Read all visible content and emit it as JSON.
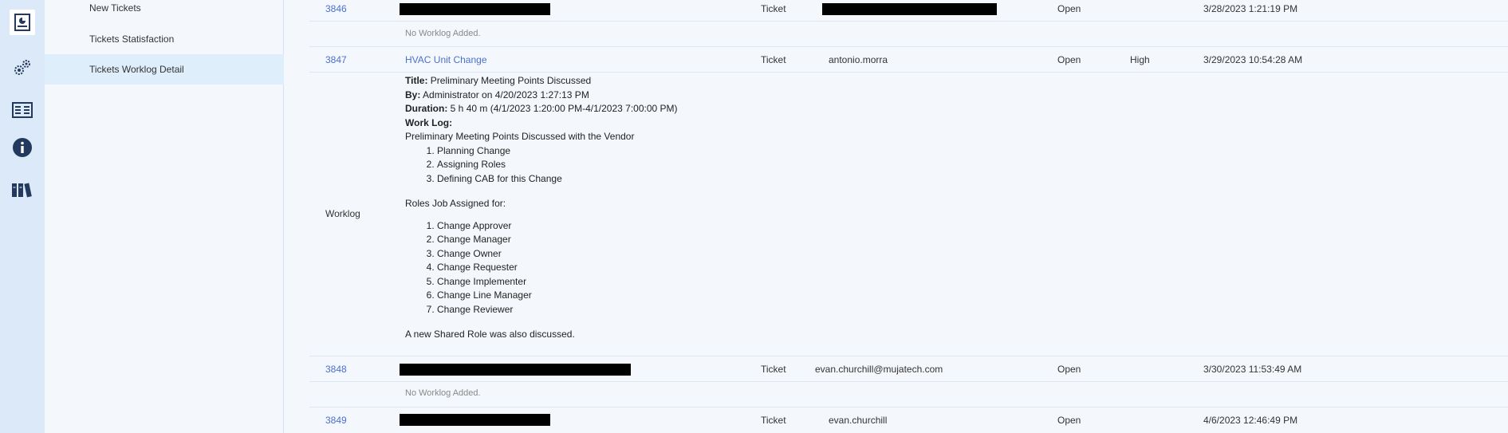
{
  "subnav": {
    "items": [
      {
        "label": "New Tickets"
      },
      {
        "label": "Tickets Statisfaction"
      },
      {
        "label": "Tickets Worklog Detail"
      }
    ]
  },
  "icons": [
    "dashboard-report-icon",
    "settings-gears-icon",
    "news-list-icon",
    "info-icon",
    "library-books-icon"
  ],
  "rows": [
    {
      "id": "3846",
      "type": "Ticket",
      "status": "Open",
      "priority": "",
      "date": "3/28/2023 1:21:19 PM",
      "worklog_empty": "No Worklog Added."
    },
    {
      "id": "3847",
      "title": "HVAC Unit Change",
      "type": "Ticket",
      "owner": "antonio.morra",
      "status": "Open",
      "priority": "High",
      "date": "3/29/2023 10:54:28 AM"
    },
    {
      "id": "3848",
      "type": "Ticket",
      "owner": "evan.churchill@mujatech.com",
      "status": "Open",
      "priority": "",
      "date": "3/30/2023 11:53:49 AM",
      "worklog_empty": "No Worklog Added."
    },
    {
      "id": "3849",
      "type": "Ticket",
      "owner": "evan.churchill",
      "status": "Open",
      "priority": "",
      "date": "4/6/2023 12:46:49 PM"
    }
  ],
  "worklog": {
    "label": "Worklog",
    "title_label": "Title:",
    "title": "Preliminary Meeting Points Discussed",
    "by_label": "By:",
    "by": "Administrator on 4/20/2023 1:27:13 PM",
    "duration_label": "Duration:",
    "duration": "5 h 40 m (4/1/2023 1:20:00 PM-4/1/2023 7:00:00 PM)",
    "worklog_label": "Work Log:",
    "intro": "Preliminary Meeting Points Discussed with the Vendor",
    "points": [
      "Planning Change",
      "Assigning Roles",
      "Defining CAB for this Change"
    ],
    "roles_intro": "Roles Job Assigned for:",
    "roles": [
      "Change Approver",
      "Change Manager",
      "Change Owner",
      "Change Requester",
      "Change Implementer",
      "Change Line Manager",
      "Change Reviewer"
    ],
    "closing": "A new Shared Role was also discussed."
  }
}
